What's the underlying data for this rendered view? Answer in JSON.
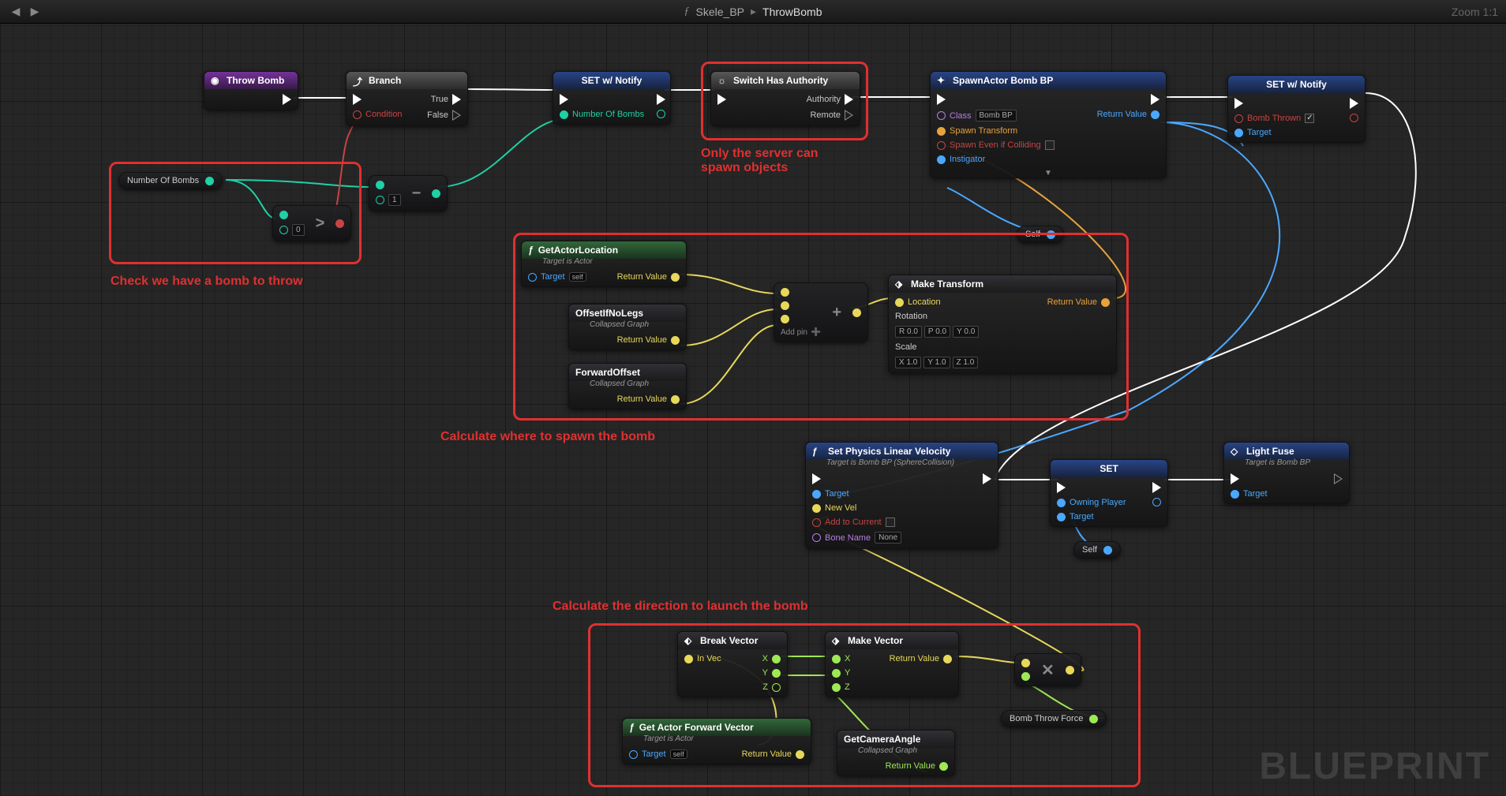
{
  "topbar": {
    "blueprint": "Skele_BP",
    "sep": "▸",
    "function": "ThrowBomb",
    "zoom": "Zoom 1:1"
  },
  "watermark": "BLUEPRINT",
  "annotations": {
    "server": "Only the server can spawn objects",
    "check": "Check we have a bomb to throw",
    "spawn": "Calculate where to spawn the bomb",
    "direction": "Calculate the direction to launch the bomb"
  },
  "nodes": {
    "throwBomb": {
      "title": "Throw Bomb"
    },
    "branch": {
      "title": "Branch",
      "cond": "Condition",
      "t": "True",
      "f": "False"
    },
    "set1": {
      "title": "SET w/ Notify",
      "var": "Number Of Bombs"
    },
    "switch": {
      "title": "Switch Has Authority",
      "auth": "Authority",
      "rem": "Remote"
    },
    "spawn": {
      "title": "SpawnActor Bomb BP",
      "class": "Class",
      "classVal": "Bomb BP",
      "transform": "Spawn Transform",
      "collide": "Spawn Even if Colliding",
      "instigator": "Instigator",
      "ret": "Return Value"
    },
    "set2": {
      "title": "SET w/ Notify",
      "var": "Bomb Thrown",
      "tgt": "Target"
    },
    "numBombs": "Number Of Bombs",
    "gt": {
      "zero": "0"
    },
    "minus": {
      "one": "1"
    },
    "getLoc": {
      "title": "GetActorLocation",
      "sub": "Target is Actor",
      "tgt": "Target",
      "self": "self",
      "ret": "Return Value"
    },
    "offset": {
      "title": "OffsetIfNoLegs",
      "sub": "Collapsed Graph",
      "ret": "Return Value"
    },
    "forward": {
      "title": "ForwardOffset",
      "sub": "Collapsed Graph",
      "ret": "Return Value"
    },
    "add": {
      "addpin": "Add pin"
    },
    "makeT": {
      "title": "Make Transform",
      "loc": "Location",
      "rot": "Rotation",
      "scale": "Scale",
      "ret": "Return Value",
      "r": "R",
      "p": "P",
      "y": "Y",
      "x": "X",
      "yv": "Y",
      "z": "Z",
      "rv": "0.0",
      "pv": "0.0",
      "yv2": "0.0",
      "xv": "1.0",
      "yvv": "1.0",
      "zv": "1.0"
    },
    "self1": "Self",
    "self2": "Self",
    "setVel": {
      "title": "Set Physics Linear Velocity",
      "sub": "Target is Bomb BP (SphereCollision)",
      "tgt": "Target",
      "vel": "New Vel",
      "add": "Add to Current",
      "bone": "Bone Name",
      "none": "None"
    },
    "set3": {
      "title": "SET",
      "own": "Owning Player",
      "tgt": "Target"
    },
    "fuse": {
      "title": "Light Fuse",
      "sub": "Target is Bomb BP",
      "tgt": "Target"
    },
    "breakV": {
      "title": "Break Vector",
      "in": "In Vec",
      "x": "X",
      "y": "Y",
      "z": "Z"
    },
    "makeV": {
      "title": "Make Vector",
      "x": "X",
      "y": "Y",
      "z": "Z",
      "ret": "Return Value"
    },
    "getFwd": {
      "title": "Get Actor Forward Vector",
      "sub": "Target is Actor",
      "tgt": "Target",
      "self": "self",
      "ret": "Return Value"
    },
    "camAngle": {
      "title": "GetCameraAngle",
      "sub": "Collapsed Graph",
      "ret": "Return Value"
    },
    "throwForce": "Bomb Throw Force"
  }
}
